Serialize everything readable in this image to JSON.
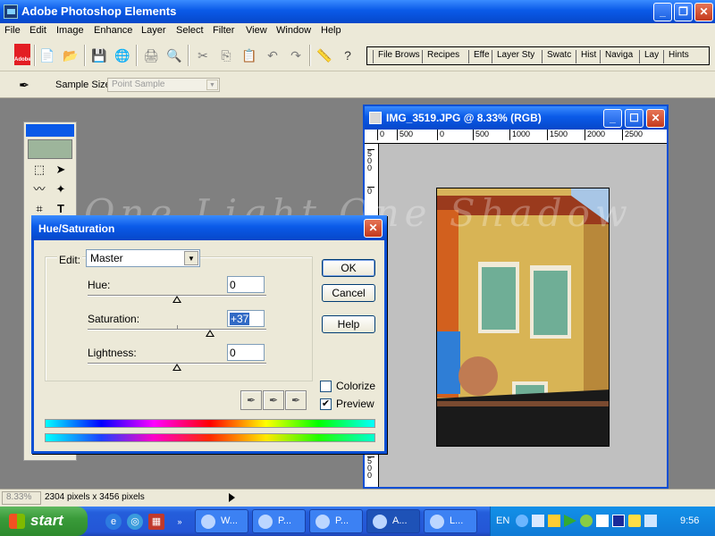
{
  "window": {
    "title": "Adobe Photoshop Elements",
    "minimize": "_",
    "restore": "❐",
    "close": "✕"
  },
  "menu": [
    "File",
    "Edit",
    "Image",
    "Enhance",
    "Layer",
    "Select",
    "Filter",
    "View",
    "Window",
    "Help"
  ],
  "toolbar": {
    "adobe_logo_text": "Adobe",
    "palette_tabs": [
      "File Brows",
      "Recipes",
      "Effe",
      "Layer Sty",
      "Swatc",
      "Hist",
      "Naviga",
      "Lay",
      "Hints"
    ]
  },
  "options_bar": {
    "sample_size_label": "Sample Size:",
    "sample_size_value": "Point Sample"
  },
  "image_window": {
    "title": "IMG_3519.JPG @ 8.33% (RGB)",
    "hruler_labels": [
      "0",
      "500",
      "0",
      "500",
      "1000",
      "1500",
      "2000",
      "2500"
    ],
    "vruler_labels": [
      "500",
      "0",
      "500",
      "500"
    ],
    "minimize": "_",
    "maximize": "☐",
    "close": "✕"
  },
  "dialog": {
    "title": "Hue/Saturation",
    "close": "✕",
    "edit_label": "Edit:",
    "edit_value": "Master",
    "hue_label": "Hue:",
    "hue_value": "0",
    "hue_level": 0.5,
    "saturation_label": "Saturation:",
    "saturation_value": "+37",
    "saturation_level": 0.685,
    "lightness_label": "Lightness:",
    "lightness_value": "0",
    "lightness_level": 0.5,
    "ok_label": "OK",
    "cancel_label": "Cancel",
    "help_label": "Help",
    "colorize_label": "Colorize",
    "colorize_checked": false,
    "preview_label": "Preview",
    "preview_checked": true
  },
  "watermark": "One Light One Shadow",
  "status_bar": {
    "zoom": "8.33%",
    "doc_size": "2304 pixels x 3456 pixels"
  },
  "taskbar": {
    "start_label": "start",
    "tasks": [
      "W...",
      "P...",
      "P...",
      "A...",
      "L..."
    ],
    "language": "EN",
    "clock": "9:56"
  }
}
